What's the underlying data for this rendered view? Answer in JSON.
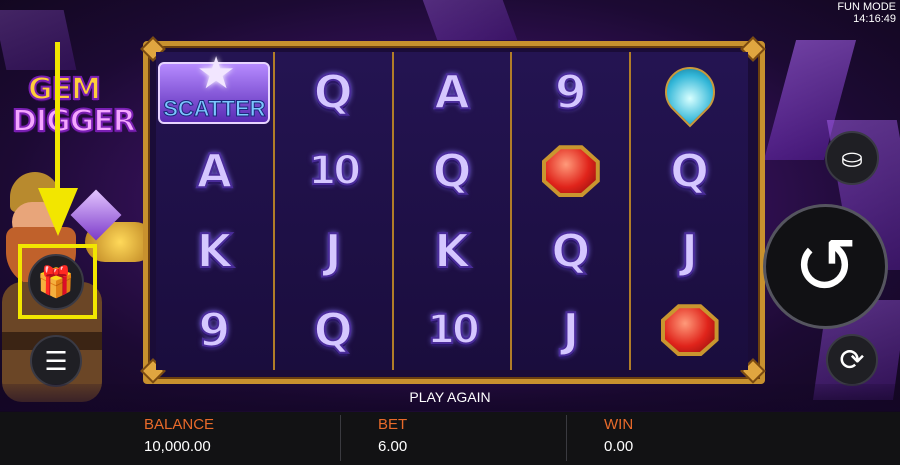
{
  "top": {
    "mode": "FUN MODE",
    "time": "14:16:49"
  },
  "logo": {
    "line1": "GEM",
    "line2": "DIGGER"
  },
  "reels": [
    [
      {
        "type": "scatter",
        "label": "SCATTER"
      },
      {
        "type": "letter",
        "label": "A"
      },
      {
        "type": "letter",
        "label": "K"
      },
      {
        "type": "letter",
        "label": "9"
      }
    ],
    [
      {
        "type": "letter",
        "label": "Q"
      },
      {
        "type": "letter",
        "label": "10"
      },
      {
        "type": "letter",
        "label": "J"
      },
      {
        "type": "letter",
        "label": "Q"
      }
    ],
    [
      {
        "type": "letter",
        "label": "A"
      },
      {
        "type": "letter",
        "label": "Q"
      },
      {
        "type": "letter",
        "label": "K"
      },
      {
        "type": "letter",
        "label": "10"
      }
    ],
    [
      {
        "type": "letter",
        "label": "9"
      },
      {
        "type": "ruby",
        "label": "red-gem"
      },
      {
        "type": "letter",
        "label": "Q"
      },
      {
        "type": "letter",
        "label": "J"
      }
    ],
    [
      {
        "type": "drop",
        "label": "blue-gem"
      },
      {
        "type": "letter",
        "label": "Q"
      },
      {
        "type": "letter",
        "label": "J"
      },
      {
        "type": "ruby",
        "label": "red-gem"
      }
    ]
  ],
  "status": "PLAY AGAIN",
  "stats": {
    "balance_label": "BALANCE",
    "balance": "10,000.00",
    "bet_label": "BET",
    "bet": "6.00",
    "win_label": "WIN",
    "win": "0.00"
  },
  "buttons": {
    "gift": "gift-icon",
    "menu": "menu-icon",
    "coins": "coins-icon",
    "spin": "spin-icon",
    "autoplay": "autoplay-icon"
  },
  "colors": {
    "highlight": "#f2e600",
    "frame": "#c8912e",
    "label": "#e86a2a"
  }
}
